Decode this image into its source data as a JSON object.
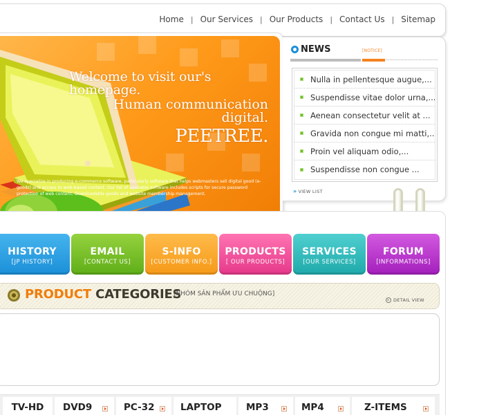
{
  "top_nav": {
    "items": [
      "Home",
      "Our Services",
      "Our Products",
      "Contact Us",
      "Sitemap"
    ],
    "separator": "|"
  },
  "banner": {
    "welcome_line1": "Welcome to visit our's homepage.",
    "welcome_line2": "Human communication digital.",
    "welcome_line3": "PEETREE.",
    "description": "We specialize in producing e-commerce software, particularly software that helps webmasters sell digital good (e-goods) and access to web-based content. Our list of available software includes scripts for secure password protection of web content, downloadable goods and website membership management."
  },
  "news": {
    "title": "NEWS",
    "tag": "[NOTICE]",
    "items": [
      "Nulla in pellentesque augue,...",
      "Suspendisse vitae dolor urna,...",
      "Aenean consectetur velit at ...",
      "Gravida non congue mi matti,...",
      "Proin vel aliquam odio,...",
      "Suspendisse non congue ..."
    ],
    "view_list": "VIEW LIST"
  },
  "tabs": [
    {
      "title": "HISTORY",
      "sub": "[JP HISTORY]"
    },
    {
      "title": "EMAIL",
      "sub": "[CONTACT US]"
    },
    {
      "title": "S-INFO",
      "sub": "[CUSTOMER INFO.]"
    },
    {
      "title": "PRODUCTS",
      "sub": "[ OUR PRODUCTS]"
    },
    {
      "title": "SERVICES",
      "sub": "[OUR SERVICES]"
    },
    {
      "title": "FORUM",
      "sub": "[INFORMATIONS]"
    }
  ],
  "categories": {
    "title_highlight": "PRODUCT",
    "title_rest": "CATEGORIES",
    "subtitle": "[NHÓM SẢN PHẨM ƯU CHUỘNG]",
    "detail_view": "DETAIL VIEW"
  },
  "products": [
    "TV-HD",
    "DVD9",
    "PC-32",
    "LAPTOP",
    "MP3",
    "MP4",
    "Z-ITEMS"
  ],
  "colors": {
    "accent_orange": "#f07d0a",
    "news_blue": "#1a8fd8",
    "bullet_green": "#6fbf2a",
    "tab_history": "#1b8fd8",
    "tab_email": "#5fae18",
    "tab_sinfo": "#f59918",
    "tab_products": "#e5388a",
    "tab_services": "#1fa9aa",
    "tab_forum": "#a41fbb"
  }
}
